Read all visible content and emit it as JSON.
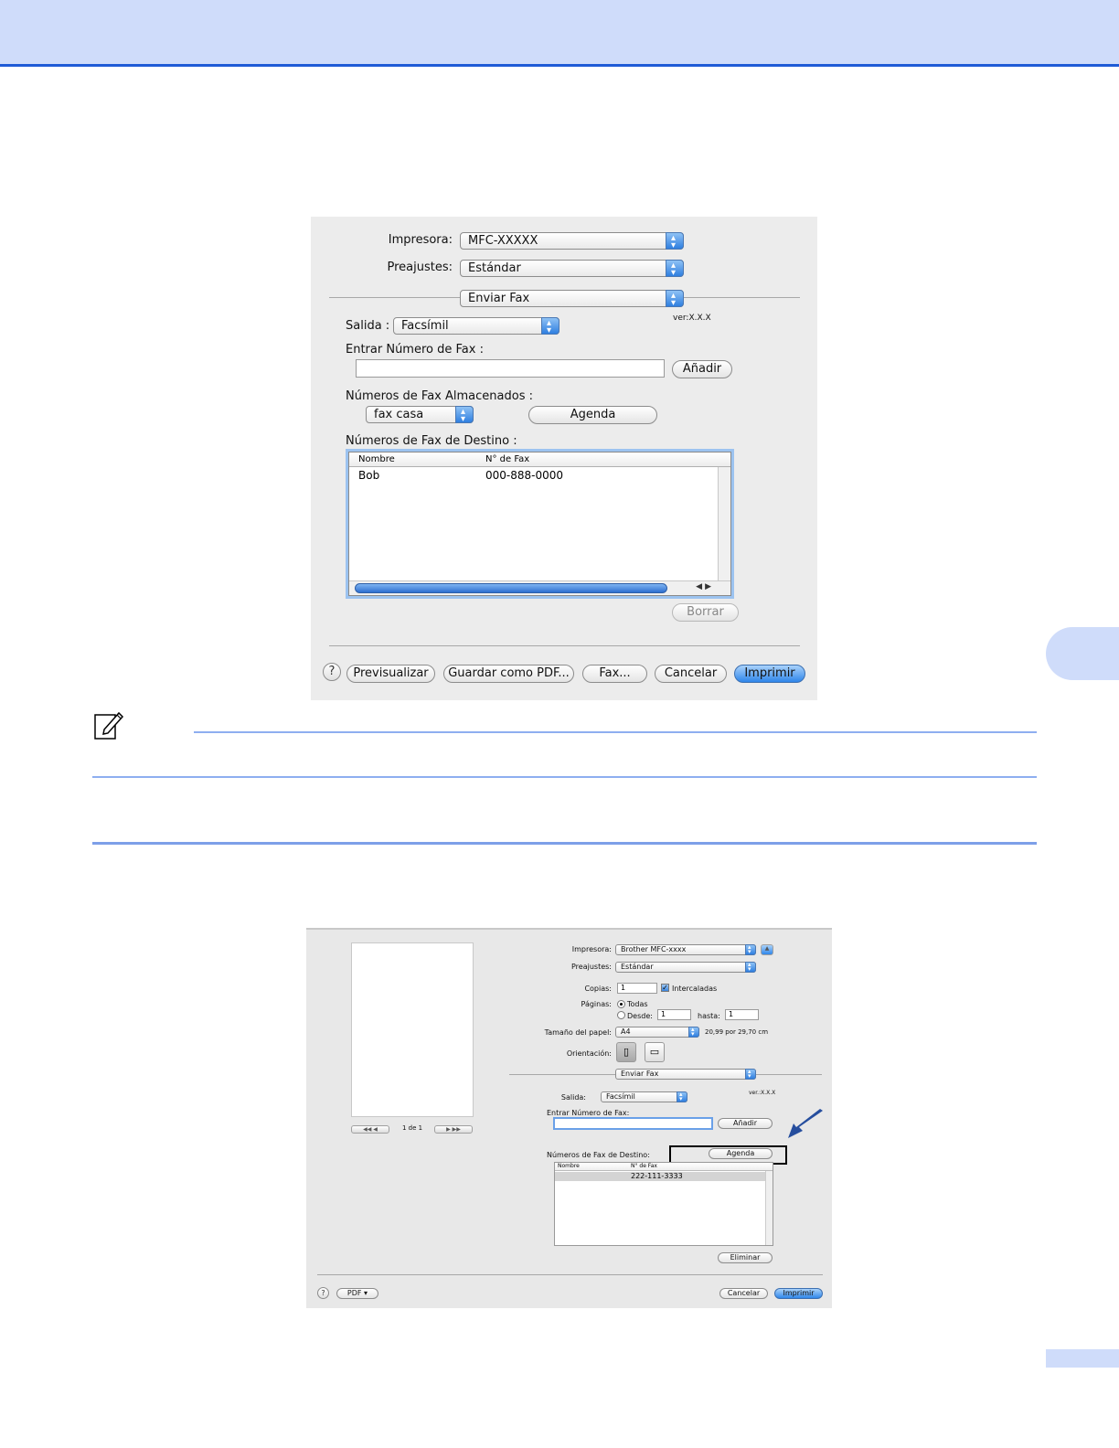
{
  "dialog1": {
    "printer_label": "Impresora:",
    "printer_value": "MFC-XXXXX",
    "presets_label": "Preajustes:",
    "presets_value": "Estándar",
    "panel_value": "Enviar Fax",
    "version": "ver:X.X.X",
    "output_label": "Salida :",
    "output_value": "Facsímil",
    "enter_fax_label": "Entrar Número de Fax :",
    "enter_fax_value": "",
    "add_button": "Añadir",
    "stored_label": "Números de Fax Almacenados :",
    "stored_value": "fax casa",
    "address_book_button": "Agenda",
    "destination_label": "Números de Fax de Destino :",
    "columns": [
      "Nombre",
      "N° de Fax"
    ],
    "rows": [
      {
        "name": "Bob",
        "fax": "000-888-0000"
      }
    ],
    "delete_button": "Borrar",
    "help": "?",
    "preview_button": "Previsualizar",
    "save_pdf_button": "Guardar como PDF...",
    "fax_button": "Fax...",
    "cancel_button": "Cancelar",
    "print_button": "Imprimir"
  },
  "dialog2": {
    "printer_label": "Impresora:",
    "printer_value": "Brother MFC-xxxx",
    "presets_label": "Preajustes:",
    "presets_value": "Estándar",
    "copies_label": "Copias:",
    "copies_value": "1",
    "collated_label": "Intercaladas",
    "collated_checked": true,
    "pages_label": "Páginas:",
    "pages_all": "Todas",
    "pages_from": "Desde:",
    "from_value": "1",
    "to_label": "hasta:",
    "to_value": "1",
    "paper_label": "Tamaño del papel:",
    "paper_value": "A4",
    "paper_dims": "20,99 por 29,70 cm",
    "orientation_label": "Orientación:",
    "panel_value": "Enviar Fax",
    "version": "ver.:X.X.X",
    "output_label": "Salida:",
    "output_value": "Facsímil",
    "enter_fax_label": "Entrar Número de Fax:",
    "enter_fax_value": "",
    "add_button": "Añadir",
    "destination_label": "Números de Fax de Destino:",
    "address_book_button": "Agenda",
    "columns": [
      "Nombre",
      "N° de Fax"
    ],
    "rows": [
      {
        "name": "",
        "fax": "222-111-3333"
      }
    ],
    "delete_button": "Eliminar",
    "page_indicator": "1 de 1",
    "help": "?",
    "pdf_button": "PDF ▾",
    "cancel_button": "Cancelar",
    "print_button": "Imprimir"
  },
  "colors": {
    "band": "#cfdcfa",
    "band_border": "#1f5bd6",
    "rule": "#8eaef0",
    "accent_button": "#2f86ea"
  }
}
